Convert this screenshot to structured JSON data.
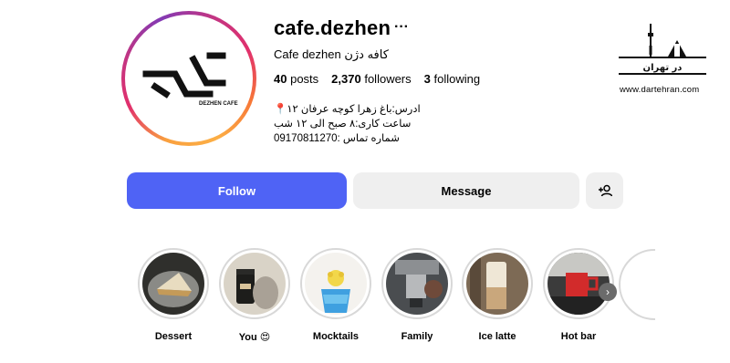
{
  "profile": {
    "username": "cafe.dezhen",
    "full_name": "Cafe dezhen کافه دژن",
    "more_icon": "ellipsis-icon",
    "avatar_logo_text": "DEZHEN CAFE",
    "stats": {
      "posts": "40",
      "posts_label": "posts",
      "followers": "2,370",
      "followers_label": "followers",
      "following": "3",
      "following_label": "following"
    },
    "bio": [
      "📍ادرس:باغ زهرا کوچه عرفان ۱۲",
      "ساعت کاری:۸ صبح الی ۱۲ شب",
      "شماره تماس :09170811270"
    ]
  },
  "actions": {
    "follow": "Follow",
    "message": "Message",
    "suggest_icon": "add-person-icon"
  },
  "highlights": [
    {
      "label": "Dessert"
    },
    {
      "label": "You 😍"
    },
    {
      "label": "Mocktails"
    },
    {
      "label": "Family"
    },
    {
      "label": "Ice latte"
    },
    {
      "label": "Hot bar"
    }
  ],
  "watermark": {
    "site": "www.dartehran.com",
    "logo_text": "در تهران"
  },
  "colors": {
    "follow": "#4f63f5",
    "secondary": "#efefef"
  }
}
